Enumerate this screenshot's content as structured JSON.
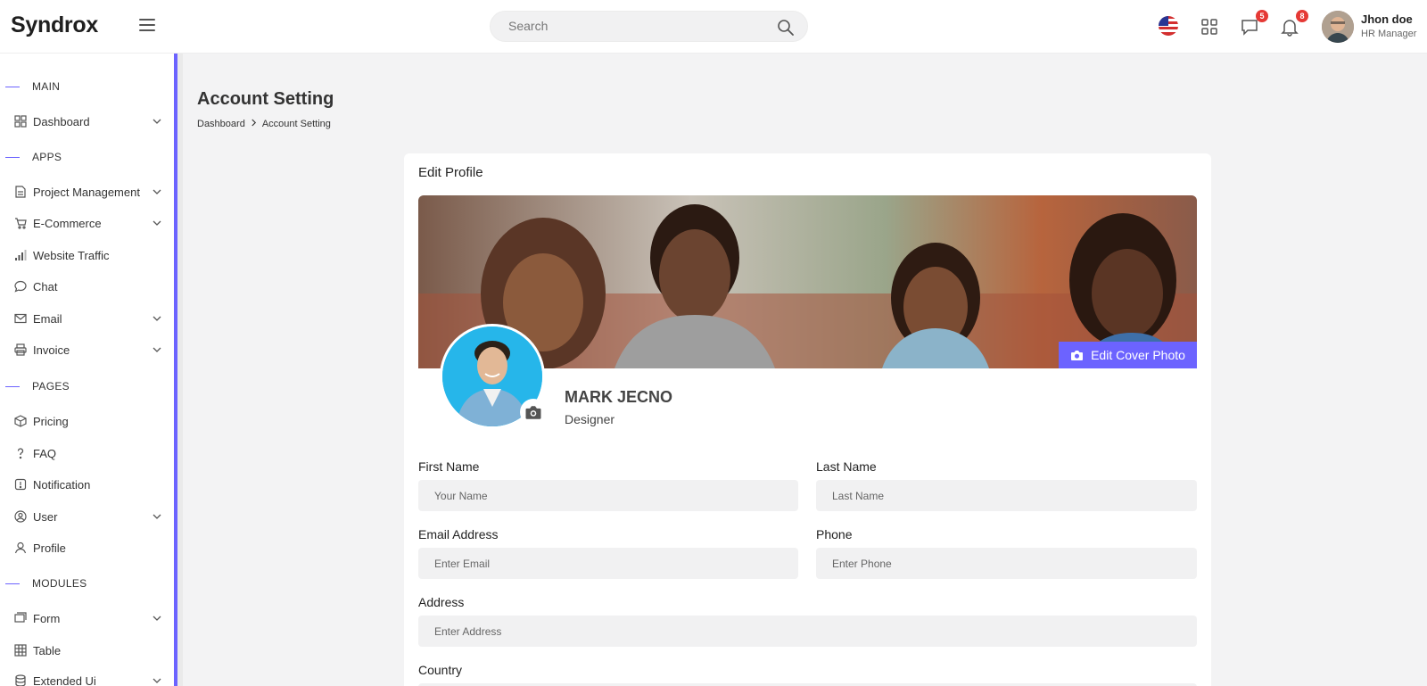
{
  "header": {
    "logo": "Syndrox",
    "search_placeholder": "Search",
    "messages_count": "5",
    "notifications_count": "8",
    "user_name": "Jhon doe",
    "user_role": "HR Manager"
  },
  "sidebar": {
    "sections": [
      "MAIN",
      "APPS",
      "PAGES",
      "MODULES"
    ],
    "items": [
      {
        "label": "Dashboard",
        "icon": "grid-icon",
        "has_children": true
      },
      {
        "label": "Project Management",
        "icon": "document-icon",
        "has_children": true
      },
      {
        "label": "E-Commerce",
        "icon": "cart-icon",
        "has_children": true
      },
      {
        "label": "Website Traffic",
        "icon": "signal-icon",
        "has_children": false
      },
      {
        "label": "Chat",
        "icon": "chat-icon",
        "has_children": false
      },
      {
        "label": "Email",
        "icon": "mail-icon",
        "has_children": true
      },
      {
        "label": "Invoice",
        "icon": "printer-icon",
        "has_children": true
      },
      {
        "label": "Pricing",
        "icon": "box-icon",
        "has_children": false
      },
      {
        "label": "FAQ",
        "icon": "question-icon",
        "has_children": false
      },
      {
        "label": "Notification",
        "icon": "alert-icon",
        "has_children": false
      },
      {
        "label": "User",
        "icon": "user-circle-icon",
        "has_children": true
      },
      {
        "label": "Profile",
        "icon": "person-icon",
        "has_children": false
      },
      {
        "label": "Form",
        "icon": "form-icon",
        "has_children": true
      },
      {
        "label": "Table",
        "icon": "table-icon",
        "has_children": false
      },
      {
        "label": "Extended Ui",
        "icon": "database-icon",
        "has_children": true
      }
    ]
  },
  "page": {
    "title": "Account Setting",
    "breadcrumb": [
      "Dashboard",
      "Account Setting"
    ]
  },
  "profile_card": {
    "title": "Edit Profile",
    "edit_cover_label": "Edit Cover Photo",
    "name": "MARK JECNO",
    "role": "Designer"
  },
  "form": {
    "first_name_label": "First Name",
    "first_name_placeholder": "Your Name",
    "last_name_label": "Last Name",
    "last_name_placeholder": "Last Name",
    "email_label": "Email Address",
    "email_placeholder": "Enter Email",
    "phone_label": "Phone",
    "phone_placeholder": "Enter Phone",
    "address_label": "Address",
    "address_placeholder": "Enter Address",
    "country_label": "Country"
  },
  "colors": {
    "accent": "#6c63ff",
    "badge": "#e53935",
    "avatar_bg": "#26b6ea"
  }
}
